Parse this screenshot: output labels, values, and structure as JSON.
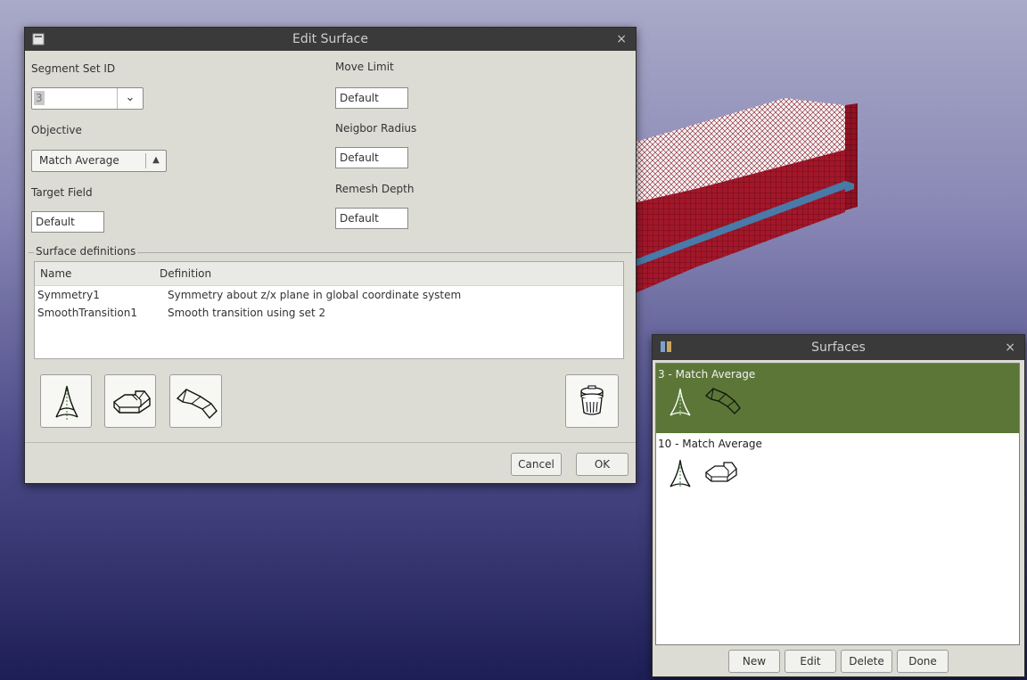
{
  "colors": {
    "titlebar": "#3a3a3a",
    "selected_row": "#5b7637",
    "mesh_red": "#9e1526",
    "mesh_top": "#f2f2f2",
    "plane_blue": "#3f85b8"
  },
  "edit_surface": {
    "title": "Edit Surface",
    "close_glyph": "×",
    "segment_set_id": {
      "label": "Segment Set ID",
      "value": "3"
    },
    "objective": {
      "label": "Objective",
      "value": "Match Average"
    },
    "target_field": {
      "label": "Target Field",
      "value": "Default"
    },
    "move_limit": {
      "label": "Move Limit",
      "value": "Default"
    },
    "neighbor_radius": {
      "label": "Neigbor Radius",
      "value": "Default"
    },
    "remesh_depth": {
      "label": "Remesh Depth",
      "value": "Default"
    },
    "surface_definitions": {
      "title": "Surface definitions",
      "columns": [
        "Name",
        "Definition"
      ],
      "rows": [
        {
          "name": "Symmetry1",
          "definition": "Symmetry about z/x plane in global coordinate system"
        },
        {
          "name": "SmoothTransition1",
          "definition": "Smooth transition using set 2"
        }
      ]
    },
    "tool_icons": [
      "symmetry-icon",
      "extrude-block-icon",
      "smooth-transition-icon",
      "trash-icon"
    ],
    "cancel_label": "Cancel",
    "ok_label": "OK"
  },
  "surfaces": {
    "title": "Surfaces",
    "close_glyph": "×",
    "items": [
      {
        "label": "3 - Match Average",
        "selected": true,
        "icons": [
          "symmetry-icon",
          "smooth-transition-icon"
        ]
      },
      {
        "label": "10 - Match Average",
        "selected": false,
        "icons": [
          "symmetry-icon",
          "extrude-block-icon"
        ]
      }
    ],
    "buttons": {
      "new": "New",
      "edit": "Edit",
      "delete": "Delete",
      "done": "Done"
    }
  }
}
